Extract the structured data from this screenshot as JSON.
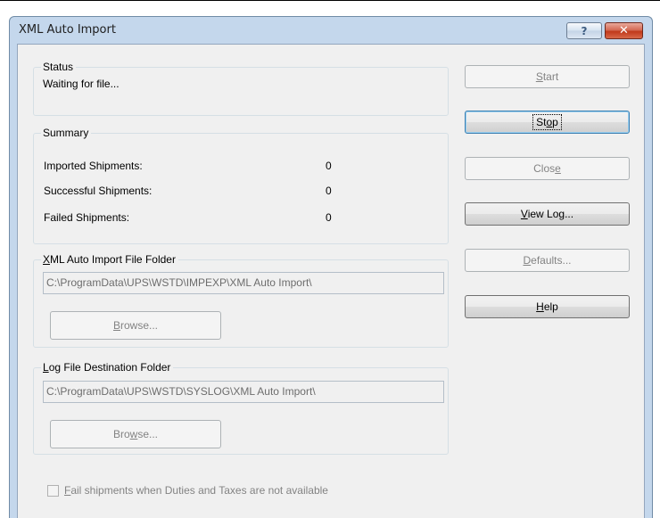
{
  "window": {
    "title": "XML Auto Import",
    "help_glyph": "?",
    "close_glyph": "✕"
  },
  "status": {
    "group_title": "Status",
    "text": "Waiting for file..."
  },
  "summary": {
    "group_title": "Summary",
    "rows": [
      {
        "label": "Imported Shipments:",
        "value": "0"
      },
      {
        "label": "Successful Shipments:",
        "value": "0"
      },
      {
        "label": "Failed Shipments:",
        "value": "0"
      }
    ]
  },
  "import_folder": {
    "group_title_mnemonic": "X",
    "group_title_rest": "ML Auto Import File Folder",
    "path": "C:\\ProgramData\\UPS\\WSTD\\IMPEXP\\XML Auto Import\\",
    "browse_mnemonic": "B",
    "browse_rest": "rowse..."
  },
  "log_folder": {
    "group_title_mnemonic": "L",
    "group_title_rest": "og File Destination Folder",
    "path": "C:\\ProgramData\\UPS\\WSTD\\SYSLOG\\XML Auto Import\\",
    "browse_pre": "Bro",
    "browse_mnemonic": "w",
    "browse_rest": "se..."
  },
  "buttons": {
    "start": {
      "mnemonic": "S",
      "rest": "tart"
    },
    "stop": {
      "pre": "St",
      "mnemonic": "o",
      "rest": "p"
    },
    "close": {
      "pre": "Clos",
      "mnemonic": "e"
    },
    "view_log": {
      "mnemonic": "V",
      "rest": "iew Log..."
    },
    "defaults": {
      "mnemonic": "D",
      "rest": "efaults..."
    },
    "help": {
      "mnemonic": "H",
      "rest": "elp"
    }
  },
  "fail_checkbox": {
    "checked": false,
    "label_mnemonic": "F",
    "label_rest": "ail shipments when Duties and Taxes are not available"
  }
}
